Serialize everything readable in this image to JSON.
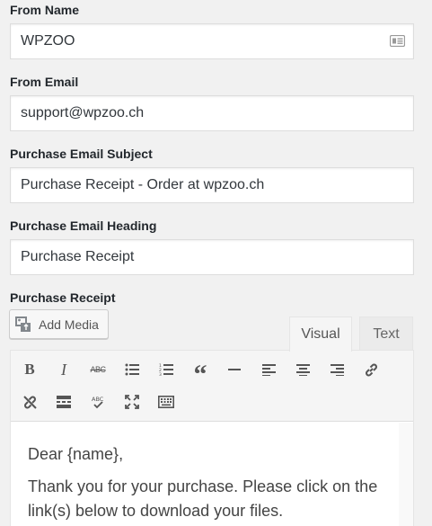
{
  "from_name": {
    "label": "From Name",
    "value": "WPZOO"
  },
  "from_email": {
    "label": "From Email",
    "value": "support@wpzoo.ch"
  },
  "subject": {
    "label": "Purchase Email Subject",
    "value": "Purchase Receipt - Order at wpzoo.ch"
  },
  "heading": {
    "label": "Purchase Email Heading",
    "value": "Purchase Receipt"
  },
  "receipt": {
    "label": "Purchase Receipt",
    "add_media_label": "Add Media",
    "tabs": {
      "visual": "Visual",
      "text": "Text"
    },
    "toolbar_row1": [
      "bold-icon",
      "italic-icon",
      "strikethrough-icon",
      "bullet-list-icon",
      "numbered-list-icon",
      "blockquote-icon",
      "horizontal-rule-icon",
      "align-left-icon",
      "align-center-icon",
      "align-right-icon",
      "insert-link-icon"
    ],
    "toolbar_row2": [
      "remove-link-icon",
      "read-more-icon",
      "spellcheck-icon",
      "fullscreen-icon",
      "toolbar-toggle-icon"
    ],
    "content": {
      "line1": "Dear {name},",
      "line2": "Thank you for your purchase. Please click on the link(s) below to download your files."
    }
  }
}
